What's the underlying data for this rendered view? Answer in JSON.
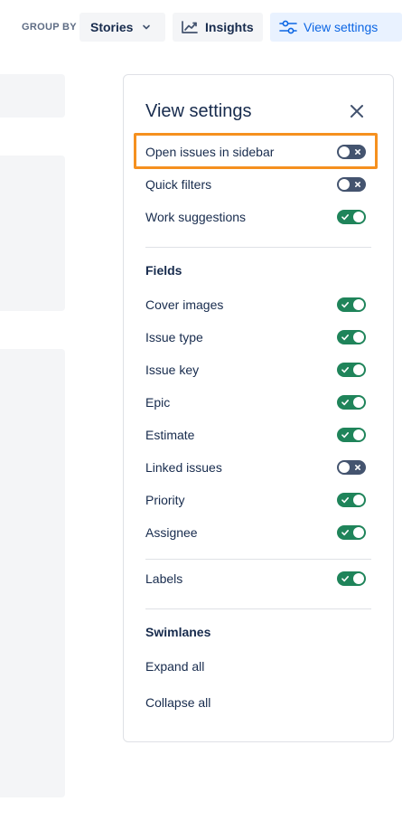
{
  "toolbar": {
    "group_by_label": "GROUP BY",
    "group_by_value": "Stories",
    "insights_label": "Insights",
    "view_settings_label": "View settings"
  },
  "panel": {
    "title": "View settings",
    "top_toggles": [
      {
        "label": "Open issues in sidebar",
        "on": false
      },
      {
        "label": "Quick filters",
        "on": false
      },
      {
        "label": "Work suggestions",
        "on": true
      }
    ],
    "fields_heading": "Fields",
    "fields": [
      {
        "label": "Cover images",
        "on": true
      },
      {
        "label": "Issue type",
        "on": true
      },
      {
        "label": "Issue key",
        "on": true
      },
      {
        "label": "Epic",
        "on": true
      },
      {
        "label": "Estimate",
        "on": true
      },
      {
        "label": "Linked issues",
        "on": false
      },
      {
        "label": "Priority",
        "on": true
      },
      {
        "label": "Assignee",
        "on": true
      }
    ],
    "labels_toggle": {
      "label": "Labels",
      "on": true
    },
    "swimlanes_heading": "Swimlanes",
    "expand_all": "Expand all",
    "collapse_all": "Collapse all"
  },
  "colors": {
    "toggle_on": "#1f845a",
    "toggle_off": "#44546f",
    "highlight": "#f5901f",
    "accent": "#0c66e4"
  },
  "icons": {
    "insights": "line-chart-icon",
    "view_settings": "sliders-icon",
    "group_by": "chevron-down-icon",
    "close": "close-icon"
  }
}
